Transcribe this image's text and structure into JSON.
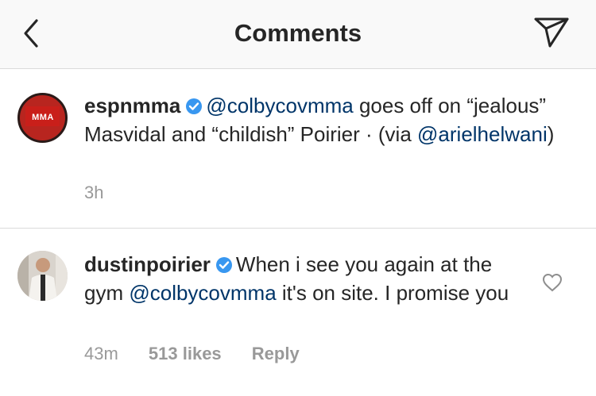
{
  "header": {
    "title": "Comments",
    "back_icon": "chevron-left-icon",
    "send_icon": "paper-plane-icon"
  },
  "caption": {
    "username": "espnmma",
    "avatar_text": "MMA",
    "mention1": "@colbycovmma",
    "text1": " goes off on “jealous” Masvidal and “childish” Poirier · (via ",
    "mention2": "@arielhelwani",
    "text2": ")",
    "time": "3h"
  },
  "comment": {
    "username": "dustinpoirier",
    "text1": "When i see you again at the gym ",
    "mention": "@colbycovmma",
    "text2": " it's on site. I promise you",
    "time": "43m",
    "likes": "513 likes",
    "reply": "Reply"
  },
  "colors": {
    "verified": "#3897f0",
    "mention": "#003569",
    "meta": "#999999"
  }
}
